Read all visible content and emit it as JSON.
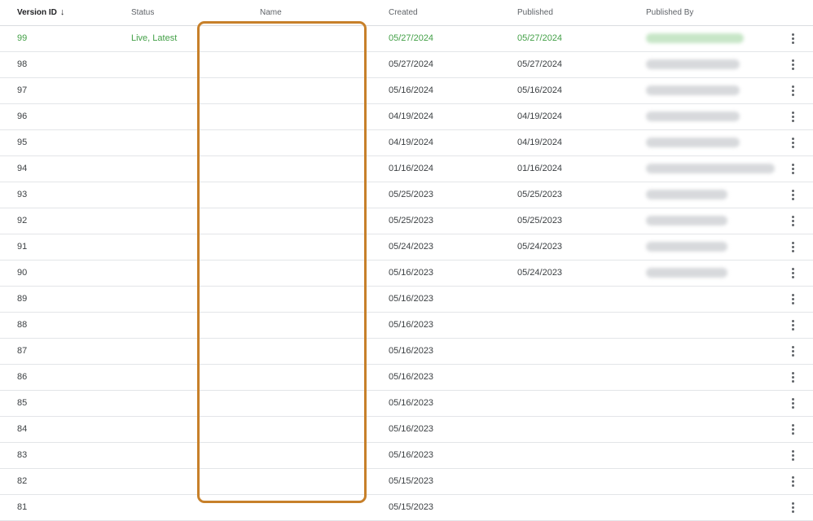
{
  "columns": {
    "version_id": "Version ID",
    "status": "Status",
    "name": "Name",
    "created": "Created",
    "published": "Published",
    "published_by": "Published By"
  },
  "sort_icon": "arrow-down-icon",
  "row_menu_icon": "more-vert-icon",
  "accent_color": "#43a047",
  "highlight_color": "#c7802a",
  "rows": [
    {
      "version": "99",
      "status": "Live, Latest",
      "created": "05/27/2024",
      "published": "05/27/2024",
      "publisher_blurred": true
    },
    {
      "version": "98",
      "status": "",
      "created": "05/27/2024",
      "published": "05/27/2024",
      "publisher_blurred": true
    },
    {
      "version": "97",
      "status": "",
      "created": "05/16/2024",
      "published": "05/16/2024",
      "publisher_blurred": true
    },
    {
      "version": "96",
      "status": "",
      "created": "04/19/2024",
      "published": "04/19/2024",
      "publisher_blurred": true
    },
    {
      "version": "95",
      "status": "",
      "created": "04/19/2024",
      "published": "04/19/2024",
      "publisher_blurred": true
    },
    {
      "version": "94",
      "status": "",
      "created": "01/16/2024",
      "published": "01/16/2024",
      "publisher_blurred": true
    },
    {
      "version": "93",
      "status": "",
      "created": "05/25/2023",
      "published": "05/25/2023",
      "publisher_blurred": true
    },
    {
      "version": "92",
      "status": "",
      "created": "05/25/2023",
      "published": "05/25/2023",
      "publisher_blurred": true
    },
    {
      "version": "91",
      "status": "",
      "created": "05/24/2023",
      "published": "05/24/2023",
      "publisher_blurred": true
    },
    {
      "version": "90",
      "status": "",
      "created": "05/16/2023",
      "published": "05/24/2023",
      "publisher_blurred": true
    },
    {
      "version": "89",
      "status": "",
      "created": "05/16/2023",
      "published": "",
      "publisher_blurred": false
    },
    {
      "version": "88",
      "status": "",
      "created": "05/16/2023",
      "published": "",
      "publisher_blurred": false
    },
    {
      "version": "87",
      "status": "",
      "created": "05/16/2023",
      "published": "",
      "publisher_blurred": false
    },
    {
      "version": "86",
      "status": "",
      "created": "05/16/2023",
      "published": "",
      "publisher_blurred": false
    },
    {
      "version": "85",
      "status": "",
      "created": "05/16/2023",
      "published": "",
      "publisher_blurred": false
    },
    {
      "version": "84",
      "status": "",
      "created": "05/16/2023",
      "published": "",
      "publisher_blurred": false
    },
    {
      "version": "83",
      "status": "",
      "created": "05/16/2023",
      "published": "",
      "publisher_blurred": false
    },
    {
      "version": "82",
      "status": "",
      "created": "05/15/2023",
      "published": "",
      "publisher_blurred": false
    },
    {
      "version": "81",
      "status": "",
      "created": "05/15/2023",
      "published": "",
      "publisher_blurred": false
    }
  ]
}
